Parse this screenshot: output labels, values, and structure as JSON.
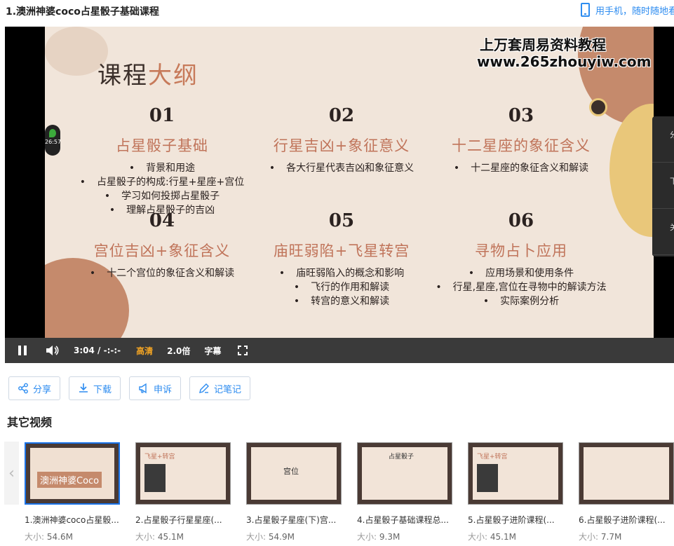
{
  "header": {
    "title": "1.澳洲神婆coco占星骰子基础课程",
    "mobile_text": "用手机，随时随地看"
  },
  "slide": {
    "title_part1": "课程",
    "title_part2": "大纲",
    "watermark_line1": "上万套周易资料教程",
    "watermark_line2": "www.265zhouyiw.com",
    "sections": [
      {
        "num": "01",
        "heading": "占星骰子基础",
        "bullets": [
          "背景和用途",
          "占星骰子的构成:行星+星座+宫位",
          "学习如何投掷占星骰子",
          "理解占星骰子的吉凶"
        ]
      },
      {
        "num": "02",
        "heading": "行星吉凶+象征意义",
        "bullets": [
          "各大行星代表吉凶和象征意义"
        ]
      },
      {
        "num": "03",
        "heading": "十二星座的象征含义",
        "bullets": [
          "十二星座的象征含义和解读"
        ]
      },
      {
        "num": "04",
        "heading": "宫位吉凶+象征含义",
        "bullets": [
          "十二个宫位的象征含义和解读"
        ]
      },
      {
        "num": "05",
        "heading": "庙旺弱陷+飞星转宫",
        "bullets": [
          "庙旺弱陷入的概念和影响",
          "飞行的作用和解读",
          "转宫的意义和解读"
        ]
      },
      {
        "num": "06",
        "heading": "寻物占卜应用",
        "bullets": [
          "应用场景和使用条件",
          "行星,星座,宫位在寻物中的解读方法",
          "实际案例分析"
        ]
      }
    ],
    "badge_time": "26:57"
  },
  "controls": {
    "time": "3:04 / -:-:-",
    "quality": "高清",
    "speed": "2.0倍",
    "subtitle": "字幕"
  },
  "side_panel": [
    "分",
    "下",
    "关"
  ],
  "actions": [
    {
      "label": "分享",
      "icon": "share-icon"
    },
    {
      "label": "下载",
      "icon": "download-icon"
    },
    {
      "label": "申诉",
      "icon": "megaphone-icon"
    },
    {
      "label": "记笔记",
      "icon": "edit-icon"
    }
  ],
  "other_videos_title": "其它视频",
  "size_label": "大小:",
  "videos": [
    {
      "title": "1.澳洲神婆coco占星骰...",
      "size": "54.6M",
      "thumb_text": "澳洲神婆Coco"
    },
    {
      "title": "2.占星骰子行星星座(...",
      "size": "45.1M",
      "thumb_text": "飞星+转宫"
    },
    {
      "title": "3.占星骰子星座(下)宫...",
      "size": "54.9M",
      "thumb_text": "宫位"
    },
    {
      "title": "4.占星骰子基础课程总...",
      "size": "9.3M",
      "thumb_text": "占星骰子"
    },
    {
      "title": "5.占星骰子进阶课程(...",
      "size": "45.1M",
      "thumb_text": "飞星+转宫"
    },
    {
      "title": "6.占星骰子进阶课程(...",
      "size": "7.7M",
      "thumb_text": ""
    }
  ]
}
